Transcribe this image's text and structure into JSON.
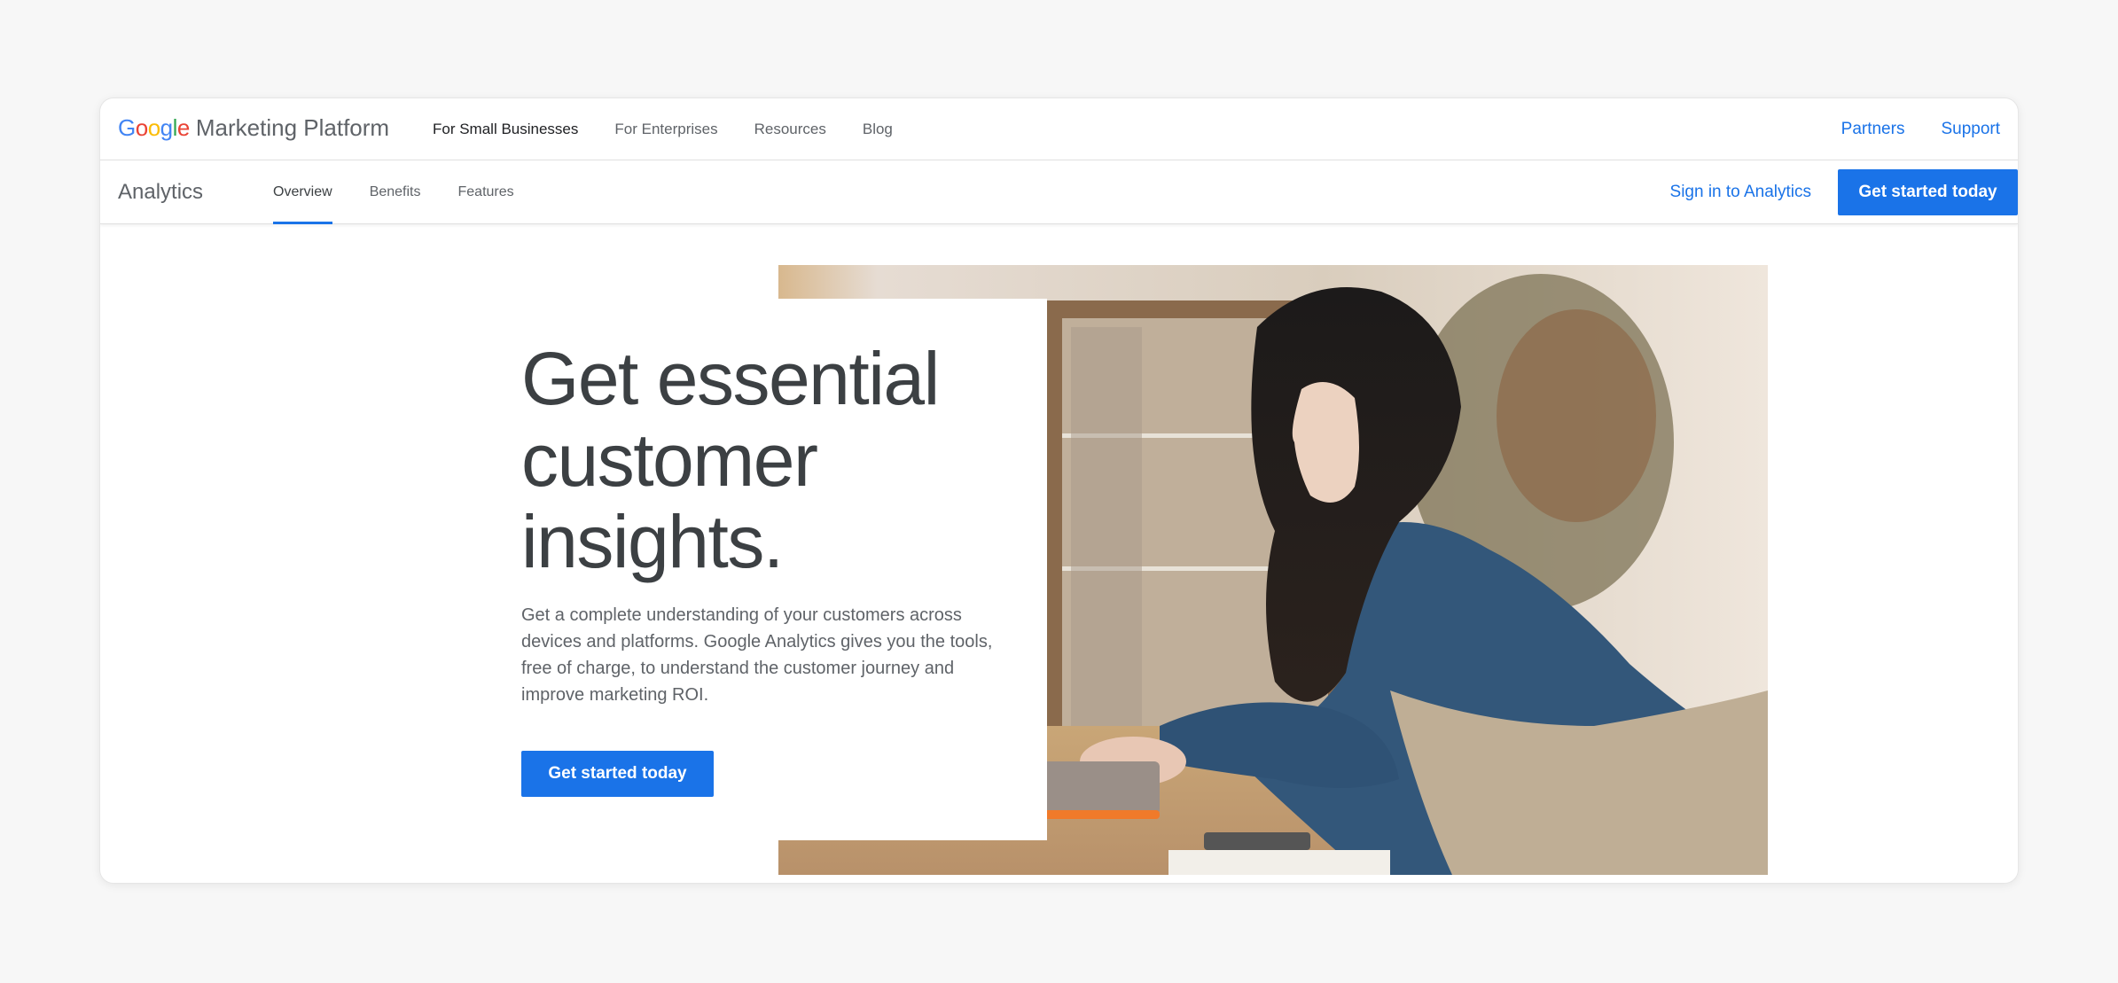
{
  "topnav": {
    "brand": {
      "google_letters": [
        {
          "char": "G",
          "color": "#4285f4"
        },
        {
          "char": "o",
          "color": "#ea4335"
        },
        {
          "char": "o",
          "color": "#fbbc05"
        },
        {
          "char": "g",
          "color": "#4285f4"
        },
        {
          "char": "l",
          "color": "#34a853"
        },
        {
          "char": "e",
          "color": "#ea4335"
        }
      ],
      "google": "Google",
      "platform": "Marketing Platform"
    },
    "links": [
      {
        "label": "For Small Businesses",
        "active": true
      },
      {
        "label": "For Enterprises",
        "active": false
      },
      {
        "label": "Resources",
        "active": false
      },
      {
        "label": "Blog",
        "active": false
      }
    ],
    "right_links": [
      {
        "label": "Partners"
      },
      {
        "label": "Support"
      }
    ]
  },
  "subnav": {
    "product": "Analytics",
    "tabs": [
      {
        "label": "Overview",
        "active": true
      },
      {
        "label": "Benefits",
        "active": false
      },
      {
        "label": "Features",
        "active": false
      }
    ],
    "signin_label": "Sign in to Analytics",
    "cta_label": "Get started today"
  },
  "hero": {
    "title_lines": [
      "Get essential",
      "customer",
      "insights."
    ],
    "description": "Get a complete understanding of your customers across devices and platforms. Google Analytics gives you the tools, free of charge, to understand the customer journey and improve marketing ROI.",
    "cta_label": "Get started today",
    "image_description": "Woman in denim shirt and apron typing on a laptop at a shop counter"
  },
  "colors": {
    "accent": "#1a73e8",
    "text_primary": "#3c4043",
    "text_secondary": "#5f6368",
    "page_background": "#f7f7f7"
  }
}
